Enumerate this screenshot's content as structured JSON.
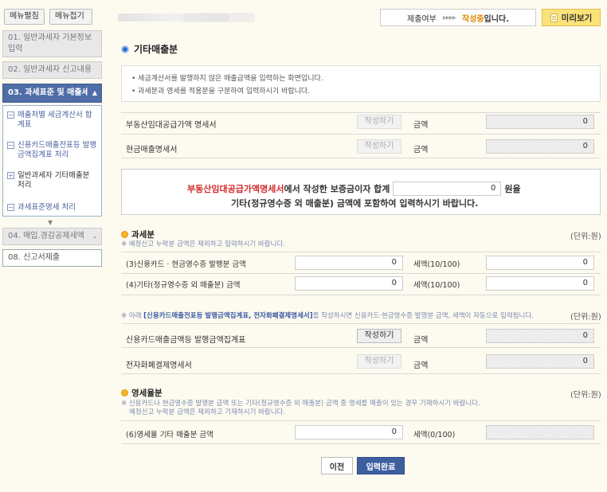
{
  "sidebar": {
    "btn_edit": "메뉴펼침",
    "btn_collapse": "메뉴접기",
    "items": [
      {
        "label": "01. 일반과세자 기본정보\n입력"
      },
      {
        "label": "02. 일반과세자 신고내용"
      },
      {
        "label": "03. 과세표준 및 매출세액"
      },
      {
        "label": "04. 매입.경감공제세액"
      },
      {
        "label": "08. 신고서제출"
      }
    ],
    "subitems": [
      {
        "label": "매출처별 세금계산서 합계표",
        "icon": "−"
      },
      {
        "label": "신용카드매출전표등 발행금액집계표 처리",
        "icon": "−"
      },
      {
        "label": "일반과세자 기타매출분 처리",
        "icon": "+"
      },
      {
        "label": "과세표준명세 처리",
        "icon": "−"
      }
    ]
  },
  "header": {
    "status_label": "제출여부",
    "status_arrows": "▸▸▸▸",
    "status_value": "작성중",
    "status_suffix": "입니다.",
    "preview_label": "미리보기"
  },
  "section": {
    "title": "기타매출분",
    "notice_1": "• 세금계산서를 발행하지 않은 매출금액을 입력하는 화면입니다.",
    "notice_2": "• 과세분과 영세를 적용분을 구분하여 입력하시기 바랍니다."
  },
  "top_rows": [
    {
      "label": "부동산임대공급가액 명세서",
      "btn": "작성하기",
      "amount_label": "금액",
      "amount": "0"
    },
    {
      "label": "현금매출명세서",
      "btn": "작성하기",
      "amount_label": "금액",
      "amount": "0"
    }
  ],
  "deposit_notice": {
    "red": "부동산임대공급가액명세서",
    "text1": "에서 작성한 보증금이자 합계",
    "value": "0",
    "text2": "원을",
    "line2": "기타(정규영수증 외 매출분) 금액에 포함하여 입력하시기 바랍니다."
  },
  "taxable": {
    "title": "과세분",
    "unit": "(단위:원)",
    "note": "※ 예정신고 누락분 금액은 제외하고 입력하시기 바랍니다.",
    "rows": [
      {
        "label": "(3)신용카드 · 현금영수증 발행분 금액",
        "amount": "0",
        "tax_label": "세액(10/100)",
        "tax": "0"
      },
      {
        "label": "(4)기타(정규영수증 외 매출분) 금액",
        "amount": "0",
        "tax_label": "세액(10/100)",
        "tax": "0"
      }
    ]
  },
  "card_notice": {
    "prefix": "※ 아래 ",
    "bold": "[신용카드매출전표등 발행금액집계표, 전자화폐결제명세서]",
    "suffix": "를 작성하시면 신용카드·현금영수증 발행분 금액, 세액이 자동으로 입력됩니다.",
    "unit": "(단위:원)"
  },
  "card_rows": [
    {
      "label": "신용카드매출금액등 발행금액집계표",
      "btn": "작성하기",
      "amount_label": "금액",
      "amount": "0"
    },
    {
      "label": "전자화폐결제명세서",
      "btn": "작성하기",
      "amount_label": "금액",
      "amount": "0"
    }
  ],
  "zero_rated": {
    "title": "영세율분",
    "unit": "(단위:원)",
    "note_1": "※ 신용카드나 현금영수증 발행분 금액 또는 기타(정규영수증 외 매출분) 금액 중 영세를 매출이 있는 경우 기재하시기 바랍니다.",
    "note_2": "예정신고 누락분 금액은 제외하고 기재하시기 바랍니다.",
    "row": {
      "label": "(6)영세율 기타 매출분 금액",
      "amount": "0",
      "tax_label": "세액(0/100)",
      "tax": ""
    }
  },
  "footer": {
    "prev": "이전",
    "done": "입력완료"
  },
  "colors": {
    "accent": "#3e5f9f",
    "highlight": "#e08a00",
    "red": "#d42a2a",
    "preview_bg": "#fbe27a"
  }
}
